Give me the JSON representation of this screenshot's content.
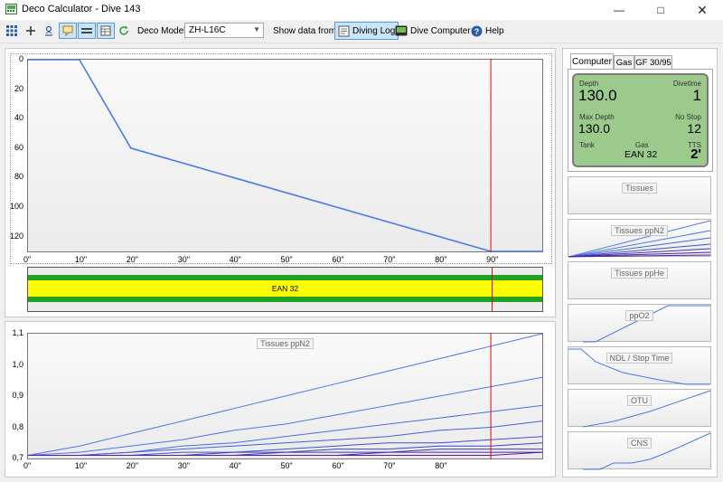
{
  "window": {
    "title": "Deco Calculator - Dive 143"
  },
  "toolbar": {
    "deco_model_label": "Deco Model:",
    "deco_model_value": "ZH-L16C",
    "show_data_label": "Show data from:",
    "diving_log_label": "Diving Log",
    "dive_computer_label": "Dive Computer",
    "help_label": "Help"
  },
  "profile_chart": {
    "y_ticks": [
      "0",
      "20",
      "40",
      "60",
      "80",
      "100",
      "120"
    ],
    "x_ticks": [
      "0\"",
      "10\"",
      "20\"",
      "30\"",
      "40\"",
      "50\"",
      "60\"",
      "70\"",
      "80\"",
      "90\""
    ],
    "gas_label": "EAN 32"
  },
  "tissues_chart": {
    "title": "Tissues ppN2",
    "y_ticks": [
      "1,1",
      "1,0",
      "0,9",
      "0,8",
      "0,7"
    ],
    "x_ticks": [
      "0\"",
      "10\"",
      "20\"",
      "30\"",
      "40\"",
      "50\"",
      "60\"",
      "70\"",
      "80\""
    ]
  },
  "tabs": [
    "Computer",
    "Gas",
    "GF 30/95"
  ],
  "computer": {
    "depth_label": "Depth",
    "depth_value": "130.0",
    "divetime_label": "Divetime",
    "divetime_value": "1",
    "maxdepth_label": "Max Depth",
    "maxdepth_value": "130.0",
    "nostop_label": "No Stop",
    "nostop_value": "12",
    "tank_label": "Tank",
    "gas_label": "Gas",
    "gas_value": "EAN 32",
    "tts_label": "TTS",
    "tts_value": "2'"
  },
  "mini_charts": [
    "Tissues",
    "Tissues ppN2",
    "Tissues ppHe",
    "ppO2",
    "NDL / Stop Time",
    "OTU",
    "CNS"
  ],
  "chart_data": [
    {
      "type": "line",
      "ylabel": "",
      "xlabel": "",
      "x": [
        0,
        10,
        20,
        90,
        100
      ],
      "series": [
        {
          "values": [
            0,
            0,
            60,
            130,
            130
          ]
        }
      ],
      "ylim": [
        130,
        0
      ],
      "xlim": [
        0,
        100
      ],
      "marker_x": 90
    },
    {
      "type": "line",
      "title": "Tissues ppN2",
      "x": [
        0,
        10,
        20,
        30,
        40,
        50,
        60,
        70,
        80,
        90,
        100
      ],
      "series": [
        {
          "values": [
            0.71,
            0.74,
            0.78,
            0.82,
            0.86,
            0.9,
            0.94,
            0.98,
            1.02,
            1.06,
            1.1
          ]
        },
        {
          "values": [
            0.71,
            0.72,
            0.74,
            0.76,
            0.79,
            0.81,
            0.84,
            0.87,
            0.9,
            0.93,
            0.96
          ]
        },
        {
          "values": [
            0.71,
            0.71,
            0.72,
            0.74,
            0.75,
            0.77,
            0.79,
            0.81,
            0.83,
            0.85,
            0.87
          ]
        },
        {
          "values": [
            0.71,
            0.71,
            0.72,
            0.73,
            0.74,
            0.75,
            0.76,
            0.77,
            0.79,
            0.8,
            0.82
          ]
        },
        {
          "values": [
            0.71,
            0.71,
            0.71,
            0.72,
            0.72,
            0.73,
            0.74,
            0.75,
            0.75,
            0.76,
            0.77
          ]
        },
        {
          "values": [
            0.71,
            0.71,
            0.71,
            0.71,
            0.72,
            0.72,
            0.73,
            0.73,
            0.74,
            0.74,
            0.75
          ]
        },
        {
          "values": [
            0.71,
            0.71,
            0.71,
            0.71,
            0.71,
            0.72,
            0.72,
            0.72,
            0.73,
            0.73,
            0.73
          ]
        },
        {
          "values": [
            0.71,
            0.71,
            0.71,
            0.71,
            0.71,
            0.71,
            0.71,
            0.72,
            0.72,
            0.72,
            0.72
          ]
        },
        {
          "values": [
            0.71,
            0.71,
            0.71,
            0.71,
            0.71,
            0.71,
            0.71,
            0.71,
            0.71,
            0.71,
            0.72
          ]
        }
      ],
      "ylim": [
        0.7,
        1.1
      ],
      "xlim": [
        0,
        100
      ],
      "marker_x": 90
    }
  ],
  "colors": {
    "profile_line": "#4d78e8",
    "marker": "#d01010",
    "gas_green": "#22a022",
    "gas_yellow": "#ffff00",
    "lcd_bg": "#9cca8c"
  }
}
